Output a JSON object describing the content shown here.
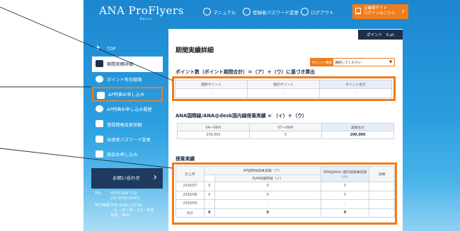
{
  "header": {
    "logo_main": "ANA Pro",
    "logo_second": "Flyers",
    "logo_sub": "Bonus",
    "nav": [
      {
        "label": "マニュアル",
        "icon": "book-icon"
      },
      {
        "label": "登録者パスワード変更",
        "icon": "key-icon"
      },
      {
        "label": "ログアウト",
        "icon": "logout-icon"
      }
    ],
    "corporate_button_line1": "企業様サイト",
    "corporate_button_line2": "ログインはこちら"
  },
  "sidebar": {
    "items": [
      {
        "label": "TOP",
        "icon": "airplane-icon"
      },
      {
        "label": "期間実績詳細",
        "icon": "chart-icon"
      },
      {
        "label": "ポイント有効期限",
        "icon": "clock-icon"
      },
      {
        "label": "AP特典お申し込み",
        "icon": "gift-icon"
      },
      {
        "label": "AP特典お申し込み履歴",
        "icon": "history-icon"
      },
      {
        "label": "登録情報変更依頼",
        "icon": "form-icon"
      },
      {
        "label": "出張者パスワード変更",
        "icon": "person-key-icon"
      },
      {
        "label": "読会お申し込み",
        "icon": "document-icon"
      }
    ],
    "contact_label": "お問い合わせ",
    "tel_label": "TEL",
    "tel_main": "0570-029-722",
    "tel_sub": "(03-5435-0547)",
    "hours_label": "受付時間",
    "hours_line1": "平日 9:00〜17:00",
    "hours_line2": "（土・日・祝・1/1・年末",
    "hours_line3": "年始　休み）"
  },
  "main": {
    "points_badge": "ポイント　5 pt",
    "page_title": "期間実績詳細",
    "filter_label": "ポイント種別",
    "filter_value": "選択してください",
    "section1_title": "ポイント数（ポイント期間合計）＝（ア）＋（ウ）に基づき算出",
    "section1_headers": [
      "国際ポイント",
      "国内ポイント",
      "ポイント合計"
    ],
    "section1_values": [
      "-",
      "-",
      "-"
    ],
    "section2_title": "ANA国際線/ANA@desk国内線搭乗実績 = （イ）＋（ウ）",
    "section2_headers": [
      "04〜06月",
      "07〜09月",
      "実績合計"
    ],
    "section2_values": [
      "200,000",
      "0",
      "200,000"
    ],
    "section3_title": "搭乗実績",
    "section3_headers": {
      "month": "計上月",
      "ap_group": "AP国際線搭乗実績（ア）",
      "ana_intl": "内ANA国際線（イ）",
      "desk": "ANA@desk 国内線搭乗実績（ウ）",
      "detail": "詳細"
    },
    "section3_rows": [
      {
        "month": "2016/07",
        "a": "0",
        "b": "0",
        "c": "0"
      },
      {
        "month": "2016/08",
        "a": "0",
        "b": "0",
        "c": "0"
      },
      {
        "month": "2016/09",
        "a": "-",
        "b": "-",
        "c": "-"
      },
      {
        "month": "合計",
        "a": "0",
        "b": "0",
        "c": "0"
      }
    ]
  },
  "colors": {
    "accent_orange": "#f07c1b",
    "navy": "#1f2f4a",
    "sky_blue": "#2a9ddf"
  }
}
